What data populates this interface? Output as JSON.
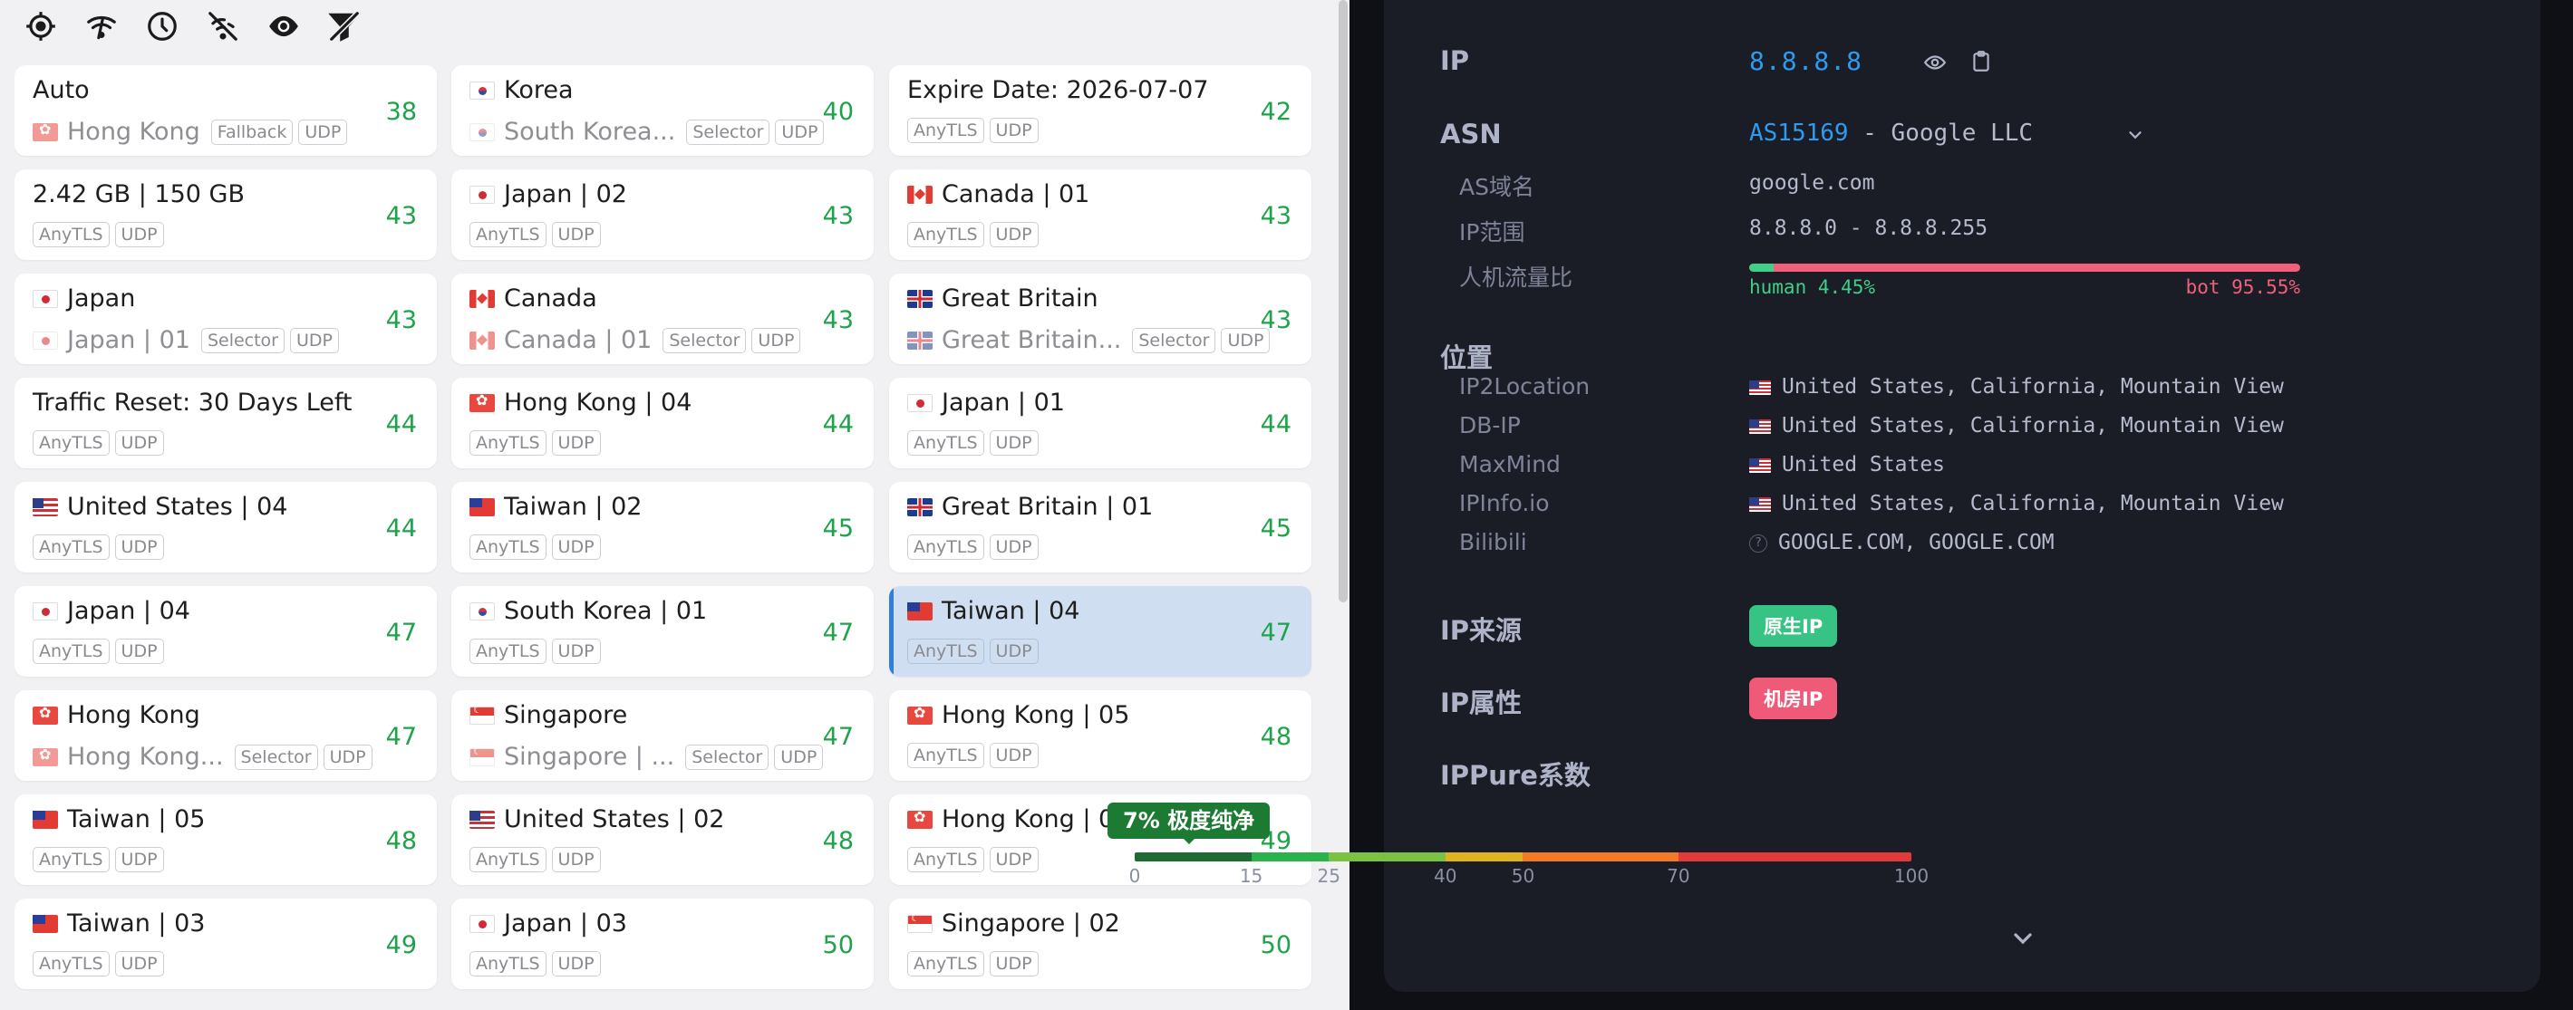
{
  "toolbar": {
    "icons": [
      "locate-icon",
      "wifi-signal-icon",
      "clock-icon",
      "no-signal-icon",
      "eye-icon",
      "filter-off-icon"
    ]
  },
  "proxies": [
    {
      "title": "Auto",
      "flag": "",
      "sub_flag": "hk",
      "sub": "Hong Kong",
      "tags": [
        "Fallback",
        "UDP"
      ],
      "delay": "38"
    },
    {
      "title": "Korea",
      "flag": "kr",
      "sub_flag": "kr",
      "sub": "South Korea...",
      "tags": [
        "Selector",
        "UDP"
      ],
      "delay": "40"
    },
    {
      "title": "Expire Date: 2026-07-07",
      "flag": "",
      "sub_flag": "",
      "sub": "",
      "tags": [
        "AnyTLS",
        "UDP"
      ],
      "delay": "42"
    },
    {
      "title": "2.42 GB | 150 GB",
      "flag": "",
      "sub_flag": "",
      "sub": "",
      "tags": [
        "AnyTLS",
        "UDP"
      ],
      "delay": "43"
    },
    {
      "title": "Japan | 02",
      "flag": "jp",
      "sub_flag": "",
      "sub": "",
      "tags": [
        "AnyTLS",
        "UDP"
      ],
      "delay": "43"
    },
    {
      "title": "Canada | 01",
      "flag": "ca",
      "sub_flag": "",
      "sub": "",
      "tags": [
        "AnyTLS",
        "UDP"
      ],
      "delay": "43"
    },
    {
      "title": "Japan",
      "flag": "jp",
      "sub_flag": "jp",
      "sub": "Japan | 01",
      "tags": [
        "Selector",
        "UDP"
      ],
      "delay": "43"
    },
    {
      "title": "Canada",
      "flag": "ca",
      "sub_flag": "ca",
      "sub": "Canada | 01",
      "tags": [
        "Selector",
        "UDP"
      ],
      "delay": "43"
    },
    {
      "title": "Great Britain",
      "flag": "gb",
      "sub_flag": "gb",
      "sub": "Great Britain...",
      "tags": [
        "Selector",
        "UDP"
      ],
      "delay": "43"
    },
    {
      "title": "Traffic Reset: 30 Days Left",
      "flag": "",
      "sub_flag": "",
      "sub": "",
      "tags": [
        "AnyTLS",
        "UDP"
      ],
      "delay": "44"
    },
    {
      "title": "Hong Kong | 04",
      "flag": "hk",
      "sub_flag": "",
      "sub": "",
      "tags": [
        "AnyTLS",
        "UDP"
      ],
      "delay": "44"
    },
    {
      "title": "Japan | 01",
      "flag": "jp",
      "sub_flag": "",
      "sub": "",
      "tags": [
        "AnyTLS",
        "UDP"
      ],
      "delay": "44"
    },
    {
      "title": "United States | 04",
      "flag": "us",
      "sub_flag": "",
      "sub": "",
      "tags": [
        "AnyTLS",
        "UDP"
      ],
      "delay": "44"
    },
    {
      "title": "Taiwan | 02",
      "flag": "tw",
      "sub_flag": "",
      "sub": "",
      "tags": [
        "AnyTLS",
        "UDP"
      ],
      "delay": "45"
    },
    {
      "title": "Great Britain | 01",
      "flag": "gb",
      "sub_flag": "",
      "sub": "",
      "tags": [
        "AnyTLS",
        "UDP"
      ],
      "delay": "45"
    },
    {
      "title": "Japan | 04",
      "flag": "jp",
      "sub_flag": "",
      "sub": "",
      "tags": [
        "AnyTLS",
        "UDP"
      ],
      "delay": "47"
    },
    {
      "title": "South Korea | 01",
      "flag": "kr",
      "sub_flag": "",
      "sub": "",
      "tags": [
        "AnyTLS",
        "UDP"
      ],
      "delay": "47"
    },
    {
      "title": "Taiwan | 04",
      "flag": "tw",
      "sub_flag": "",
      "sub": "",
      "tags": [
        "AnyTLS",
        "UDP"
      ],
      "delay": "47",
      "selected": true
    },
    {
      "title": "Hong Kong",
      "flag": "hk",
      "sub_flag": "hk",
      "sub": "Hong Kong...",
      "tags": [
        "Selector",
        "UDP"
      ],
      "delay": "47"
    },
    {
      "title": "Singapore",
      "flag": "sg",
      "sub_flag": "sg",
      "sub": "Singapore | ...",
      "tags": [
        "Selector",
        "UDP"
      ],
      "delay": "47"
    },
    {
      "title": "Hong Kong | 05",
      "flag": "hk",
      "sub_flag": "",
      "sub": "",
      "tags": [
        "AnyTLS",
        "UDP"
      ],
      "delay": "48"
    },
    {
      "title": "Taiwan | 05",
      "flag": "tw",
      "sub_flag": "",
      "sub": "",
      "tags": [
        "AnyTLS",
        "UDP"
      ],
      "delay": "48"
    },
    {
      "title": "United States | 02",
      "flag": "us",
      "sub_flag": "",
      "sub": "",
      "tags": [
        "AnyTLS",
        "UDP"
      ],
      "delay": "48"
    },
    {
      "title": "Hong Kong | 02",
      "flag": "hk",
      "sub_flag": "",
      "sub": "",
      "tags": [
        "AnyTLS",
        "UDP"
      ],
      "delay": "49"
    },
    {
      "title": "Taiwan | 03",
      "flag": "tw",
      "sub_flag": "",
      "sub": "",
      "tags": [
        "AnyTLS",
        "UDP"
      ],
      "delay": "49"
    },
    {
      "title": "Japan | 03",
      "flag": "jp",
      "sub_flag": "",
      "sub": "",
      "tags": [
        "AnyTLS",
        "UDP"
      ],
      "delay": "50"
    },
    {
      "title": "Singapore | 02",
      "flag": "sg",
      "sub_flag": "",
      "sub": "",
      "tags": [
        "AnyTLS",
        "UDP"
      ],
      "delay": "50"
    }
  ],
  "ip_info": {
    "ip_label": "IP",
    "ip_value": "8.8.8.8",
    "asn_label": "ASN",
    "asn_number": "AS15169",
    "asn_name": " - Google LLC",
    "as_domain_label": "AS域名",
    "as_domain_value": "google.com",
    "ip_range_label": "IP范围",
    "ip_range_value": "8.8.8.0 - 8.8.8.255",
    "traffic_ratio_label": "人机流量比",
    "human_text": "human 4.45%",
    "bot_text": "bot 95.55%",
    "human_ratio": 0.0445,
    "location_label": "位置",
    "locations": [
      {
        "source": "IP2Location",
        "value": "United States, California, Mountain View",
        "flag": "us"
      },
      {
        "source": "DB-IP",
        "value": "United States, California, Mountain View",
        "flag": "us"
      },
      {
        "source": "MaxMind",
        "value": "United States",
        "flag": "us"
      },
      {
        "source": "IPInfo.io",
        "value": "United States, California, Mountain View",
        "flag": "us"
      },
      {
        "source": "Bilibili",
        "value": "GOOGLE.COM, GOOGLE.COM",
        "flag": "unknown"
      }
    ],
    "ip_source_label": "IP来源",
    "ip_source_badge": "原生IP",
    "ip_attr_label": "IP属性",
    "ip_attr_badge": "机房IP",
    "ippure_label": "IPPure系数",
    "ippure_value_label": "7% 极度纯净",
    "ippure_value": 7,
    "ippure_ticks": [
      "0",
      "15",
      "25",
      "40",
      "50",
      "70",
      "100"
    ],
    "colors": {
      "accent_blue": "#2d9cf0",
      "human_green": "#3fcf88",
      "bot_red": "#f0607a",
      "native_badge": "#36c383",
      "dc_badge": "#ee5a78",
      "pure_label_bg": "#1d7a32"
    }
  }
}
